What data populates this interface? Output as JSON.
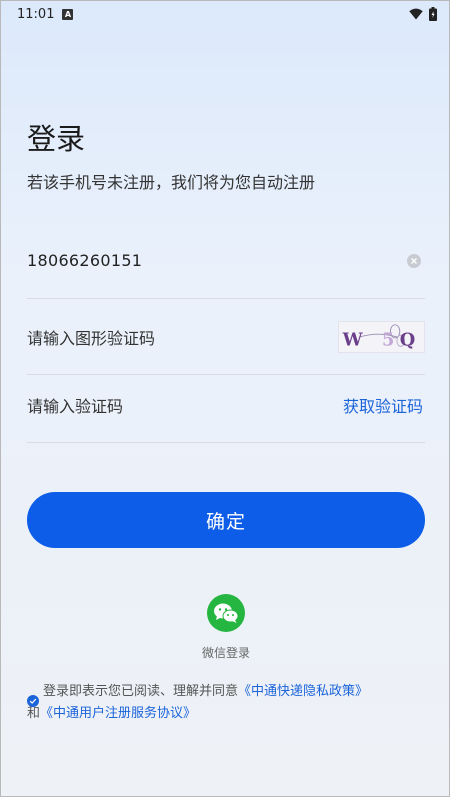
{
  "status_bar": {
    "time": "11:01",
    "notification_icon": "A"
  },
  "login": {
    "title": "登录",
    "subtitle": "若该手机号未注册，我们将为您自动注册"
  },
  "form": {
    "phone_value": "18066260151",
    "captcha_placeholder": "请输入图形验证码",
    "captcha_image_text": "W   5Q",
    "code_placeholder": "请输入验证码",
    "get_code_label": "获取验证码",
    "confirm_label": "确定"
  },
  "wechat": {
    "label": "微信登录",
    "brand_color": "#25b541"
  },
  "agreement": {
    "prefix": "登录即表示您已阅读、理解并同意",
    "privacy_link": "《中通快递隐私政策》",
    "conjunction": "和",
    "service_link": "《中通用户注册服务协议》"
  },
  "colors": {
    "accent": "#0d5de8",
    "link": "#1b64da"
  }
}
